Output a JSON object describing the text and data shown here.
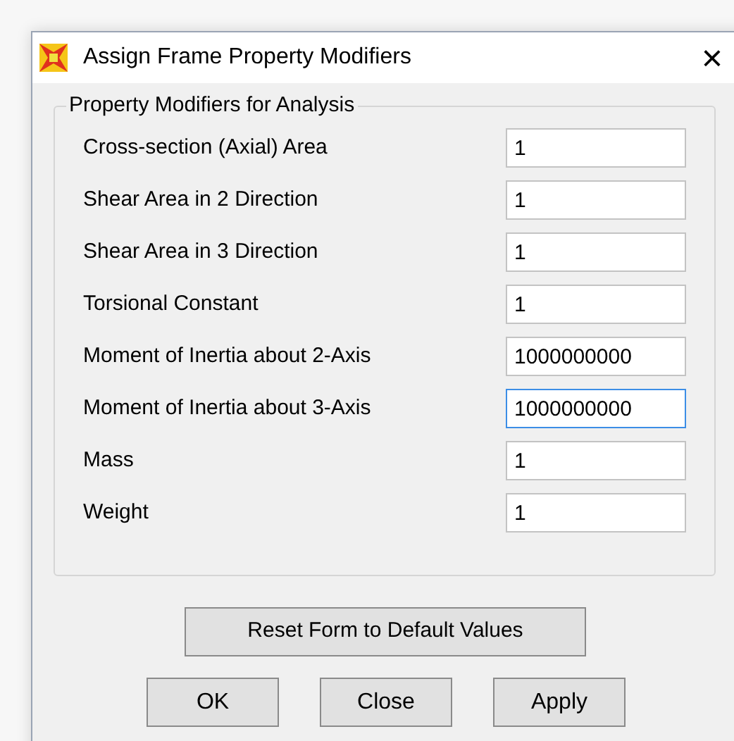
{
  "window": {
    "title": "Assign Frame Property Modifiers",
    "close": "×"
  },
  "group": {
    "title": "Property Modifiers for Analysis",
    "fields": [
      {
        "label": "Cross-section (Axial) Area",
        "value": "1",
        "focused": false
      },
      {
        "label": "Shear Area in 2 Direction",
        "value": "1",
        "focused": false
      },
      {
        "label": "Shear Area in 3 Direction",
        "value": "1",
        "focused": false
      },
      {
        "label": "Torsional Constant",
        "value": "1",
        "focused": false
      },
      {
        "label": "Moment of Inertia about 2-Axis",
        "value": "1000000000",
        "focused": false
      },
      {
        "label": "Moment of Inertia about 3-Axis",
        "value": "1000000000",
        "focused": true
      },
      {
        "label": "Mass",
        "value": "1",
        "focused": false
      },
      {
        "label": "Weight",
        "value": "1",
        "focused": false
      }
    ]
  },
  "reset_button": "Reset Form to Default Values",
  "buttons": [
    "OK",
    "Close",
    "Apply"
  ]
}
